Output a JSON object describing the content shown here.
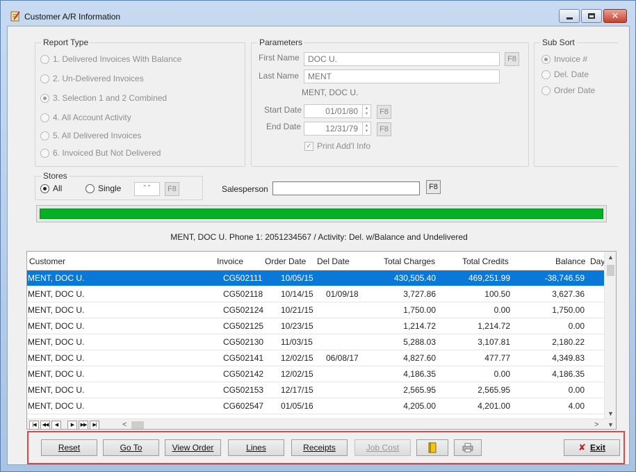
{
  "window": {
    "title": "Customer A/R Information"
  },
  "report_type": {
    "title": "Report Type",
    "options": [
      {
        "label": "1. Delivered Invoices With Balance",
        "checked": false
      },
      {
        "label": "2. Un-Delivered Invoices",
        "checked": false
      },
      {
        "label": "3. Selection 1 and 2 Combined",
        "checked": true
      },
      {
        "label": "4. All Account Activity",
        "checked": false
      },
      {
        "label": "5. All Delivered Invoices",
        "checked": false
      },
      {
        "label": "6. Invoiced But Not Delivered",
        "checked": false
      }
    ]
  },
  "parameters": {
    "title": "Parameters",
    "first_name_label": "First Name",
    "first_name_value": "DOC U.",
    "last_name_label": "Last Name",
    "last_name_value": "MENT",
    "full_name_display": "MENT, DOC U.",
    "start_date_label": "Start Date",
    "start_date_value": "01/01/80",
    "end_date_label": "End Date",
    "end_date_value": "12/31/79",
    "print_addl_label": "Print Add'l Info",
    "f8_label": "F8"
  },
  "sub_sort": {
    "title": "Sub Sort",
    "options": [
      {
        "label": "Invoice #",
        "checked": true
      },
      {
        "label": "Del. Date",
        "checked": false
      },
      {
        "label": "Order Date",
        "checked": false
      }
    ]
  },
  "stores": {
    "title": "Stores",
    "all_label": "All",
    "single_label": "Single",
    "single_value": "\" \"",
    "f8_label": "F8"
  },
  "salesperson": {
    "label": "Salesperson",
    "value": "",
    "f8_label": "F8"
  },
  "progress": {
    "percent": 100,
    "color": "#06b025"
  },
  "status_line": "MENT, DOC U. Phone 1: 2051234567 /  Activity: Del. w/Balance and Undelivered",
  "grid": {
    "columns": [
      "Customer",
      "Invoice",
      "Order Date",
      "Del Date",
      "Total Charges",
      "Total Credits",
      "Balance",
      "Day"
    ],
    "rows": [
      {
        "customer": "MENT, DOC U.",
        "invoice": "CG502111",
        "order_date": "10/05/15",
        "del_date": "",
        "charges": "430,505.40",
        "credits": "469,251.99",
        "balance": "-38,746.59",
        "selected": true
      },
      {
        "customer": "MENT, DOC U.",
        "invoice": "CG502118",
        "order_date": "10/14/15",
        "del_date": "01/09/18",
        "charges": "3,727.86",
        "credits": "100.50",
        "balance": "3,627.36",
        "selected": false
      },
      {
        "customer": "MENT, DOC U.",
        "invoice": "CG502124",
        "order_date": "10/21/15",
        "del_date": "",
        "charges": "1,750.00",
        "credits": "0.00",
        "balance": "1,750.00",
        "selected": false
      },
      {
        "customer": "MENT, DOC U.",
        "invoice": "CG502125",
        "order_date": "10/23/15",
        "del_date": "",
        "charges": "1,214.72",
        "credits": "1,214.72",
        "balance": "0.00",
        "selected": false
      },
      {
        "customer": "MENT, DOC U.",
        "invoice": "CG502130",
        "order_date": "11/03/15",
        "del_date": "",
        "charges": "5,288.03",
        "credits": "3,107.81",
        "balance": "2,180.22",
        "selected": false
      },
      {
        "customer": "MENT, DOC U.",
        "invoice": "CG502141",
        "order_date": "12/02/15",
        "del_date": "06/08/17",
        "charges": "4,827.60",
        "credits": "477.77",
        "balance": "4,349.83",
        "selected": false
      },
      {
        "customer": "MENT, DOC U.",
        "invoice": "CG502142",
        "order_date": "12/02/15",
        "del_date": "",
        "charges": "4,186.35",
        "credits": "0.00",
        "balance": "4,186.35",
        "selected": false
      },
      {
        "customer": "MENT, DOC U.",
        "invoice": "CG502153",
        "order_date": "12/17/15",
        "del_date": "",
        "charges": "2,565.95",
        "credits": "2,565.95",
        "balance": "0.00",
        "selected": false
      },
      {
        "customer": "MENT, DOC U.",
        "invoice": "CG602547",
        "order_date": "01/05/16",
        "del_date": "",
        "charges": "4,205.00",
        "credits": "4,201.00",
        "balance": "4.00",
        "selected": false
      }
    ]
  },
  "buttons": {
    "reset": "Reset",
    "goto": "Go To",
    "view_order": "View Order",
    "lines": "Lines",
    "receipts": "Receipts",
    "job_cost": "Job Cost",
    "exit": "Exit"
  }
}
